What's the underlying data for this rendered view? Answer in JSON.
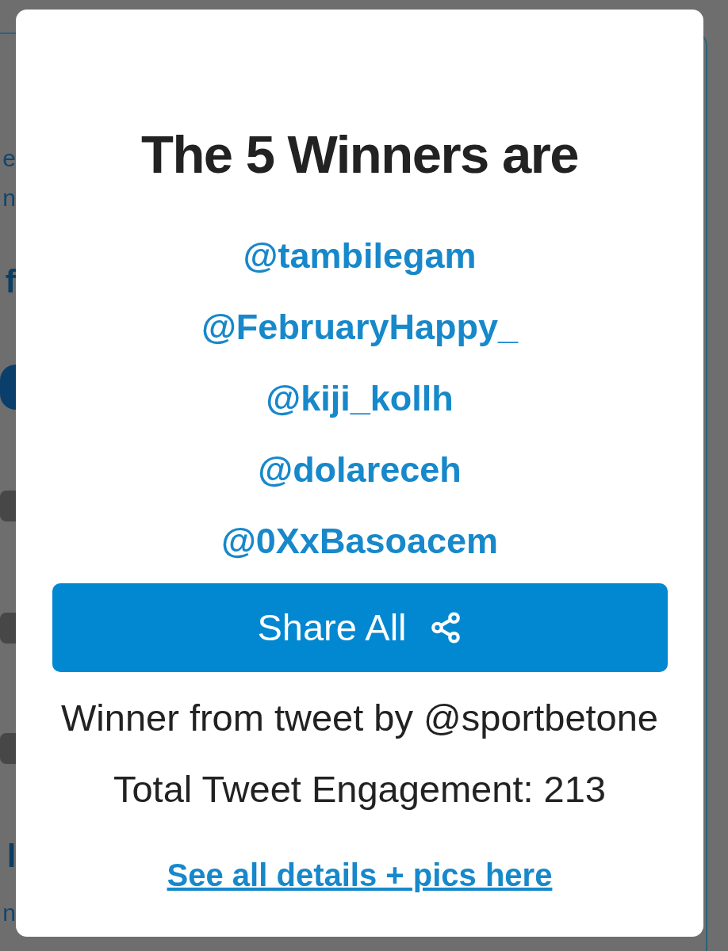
{
  "background_page": {
    "items": [
      {
        "kind": "text",
        "text": "e"
      },
      {
        "kind": "text",
        "text": "n"
      },
      {
        "kind": "heading",
        "text": "f"
      },
      {
        "kind": "button"
      },
      {
        "kind": "field"
      },
      {
        "kind": "field"
      },
      {
        "kind": "field"
      },
      {
        "kind": "heading",
        "text": "l"
      },
      {
        "kind": "text",
        "text": "n"
      }
    ]
  },
  "dialog": {
    "title": "The 5 Winners are",
    "winners": [
      "@tambilegam",
      "@FebruaryHappy_",
      "@kiji_kollh",
      "@dolareceh",
      "@0XxBasoacem"
    ],
    "share_button": {
      "label": "Share All"
    },
    "source": "Winner from tweet by @sportbetone",
    "engagement": "Total Tweet Engagement: 213",
    "details_link": "See all details + pics here"
  }
}
